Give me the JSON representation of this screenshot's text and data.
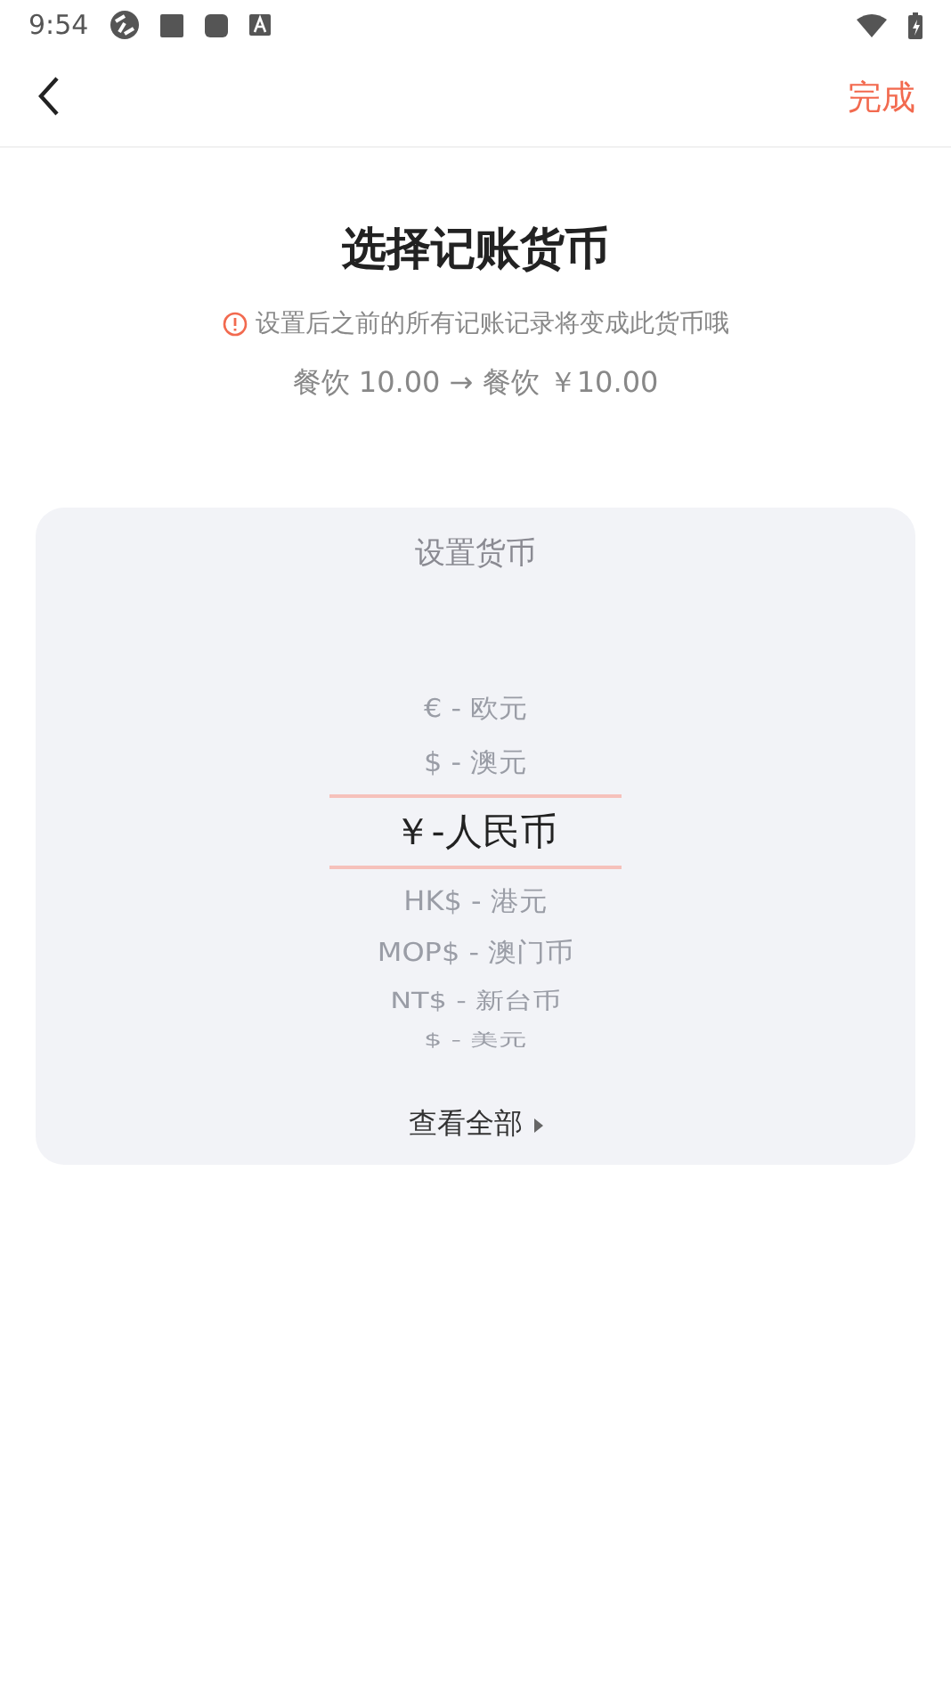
{
  "status_bar": {
    "time": "9:54"
  },
  "nav": {
    "action": "完成"
  },
  "header": {
    "title": "选择记账货币",
    "warning": "设置后之前的所有记账记录将变成此货币哦",
    "example": "餐饮 10.00 → 餐饮 ￥10.00"
  },
  "picker": {
    "title": "设置货币",
    "items": [
      {
        "label": "€ - 欧元",
        "selected": false
      },
      {
        "label": "$ - 澳元",
        "selected": false
      },
      {
        "label": "￥-人民币",
        "selected": true
      },
      {
        "label": "HK$ - 港元",
        "selected": false
      },
      {
        "label": "MOP$ - 澳门币",
        "selected": false
      },
      {
        "label": "NT$ - 新台币",
        "selected": false
      },
      {
        "label": "$ - 美元",
        "selected": false
      }
    ],
    "more": "查看全部"
  }
}
